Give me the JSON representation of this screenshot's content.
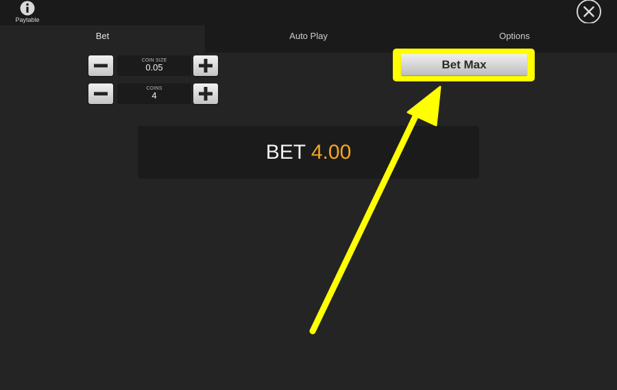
{
  "header": {
    "paytable_label": "Paytable",
    "info_icon": "info-icon",
    "close_icon": "close-icon"
  },
  "tabs": [
    {
      "label": "Bet",
      "active": true
    },
    {
      "label": "Auto Play",
      "active": false
    },
    {
      "label": "Options",
      "active": false
    }
  ],
  "bet_panel": {
    "coin_size": {
      "label": "COIN SIZE",
      "value": "0.05"
    },
    "coins": {
      "label": "COINS",
      "value": "4"
    },
    "bet_max_label": "Bet Max",
    "total": {
      "label": "BET",
      "amount": "4.00"
    }
  },
  "colors": {
    "background": "#242424",
    "bar": "#1a1a1a",
    "highlight": "#ffff00",
    "bet_amount": "#f5a623"
  }
}
